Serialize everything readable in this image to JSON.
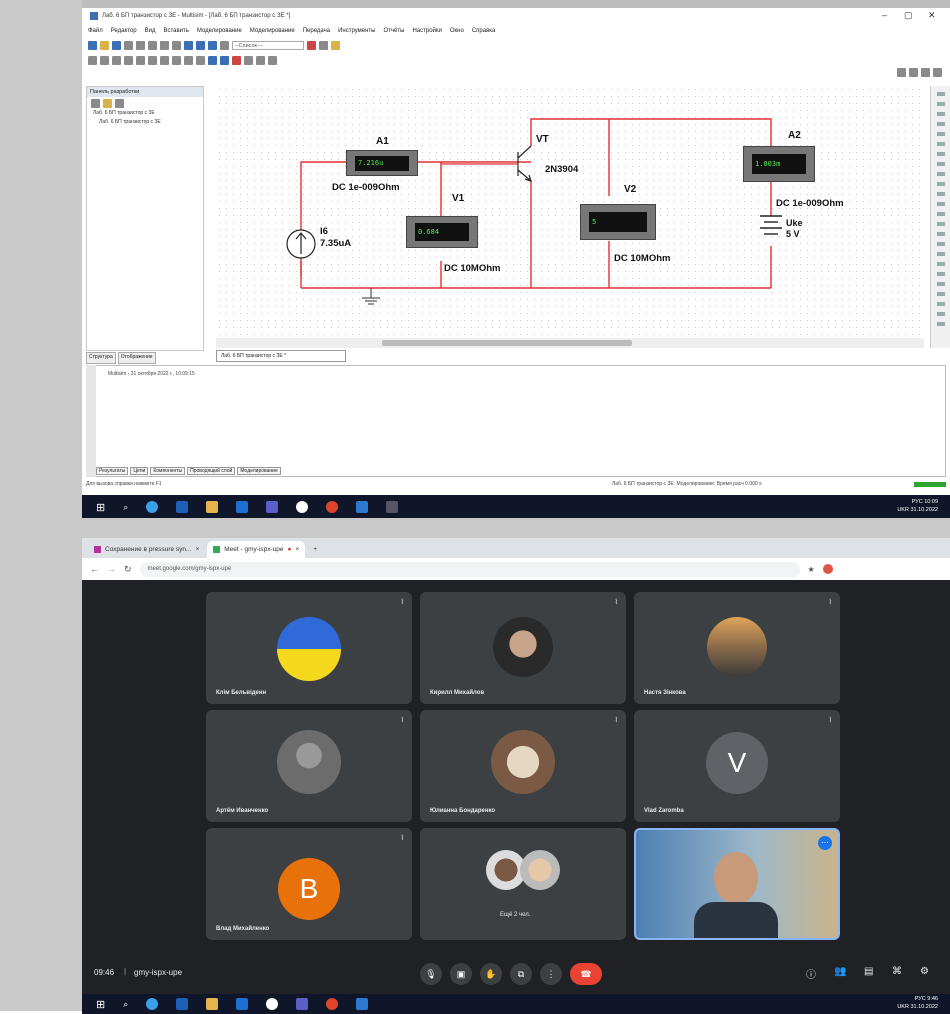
{
  "multisim": {
    "title": "Лаб. 6 БП транзистор с ЗЕ - Multisim - [Лаб. 6 БП транзистор с ЗЕ *]",
    "menu": [
      "Файл",
      "Редактор",
      "Вид",
      "Вставить",
      "Моделирование",
      "Моделирование",
      "Передача",
      "Инструменты",
      "Отчёты",
      "Настройки",
      "Окно",
      "Справка"
    ],
    "mode_dropdown": "--Список---",
    "sidebar": {
      "title": "Панель разработки",
      "items": [
        "Лаб. 6 БП транзистор с ЗЕ",
        "Лаб. 6 БП транзистор с ЗЕ"
      ]
    },
    "sidebar_tabs": [
      "Структура",
      "Отображение"
    ],
    "document_tab": "Лаб. 6 БП транзистор с ЗЕ *",
    "log_line": "Multisim - 31 октября 2022 г., 10:09:15",
    "log_tabs": [
      "Результаты",
      "Цепи",
      "Компоненты",
      "Проводящий слой",
      "Моделирование"
    ],
    "status_left": "Для вызова справки нажмите F1",
    "status_right": "Лаб. 6 БП транзистор с ЗЕ: Моделирование: Время расч 0.000 s",
    "circuit": {
      "A1": {
        "label": "A1",
        "value": "7.216u",
        "mode": "DC  1e-009Ohm"
      },
      "V1": {
        "label": "V1",
        "value": "0.684",
        "mode": "DC  10MOhm"
      },
      "V2": {
        "label": "V2",
        "value": "5",
        "mode": "DC  10MOhm"
      },
      "A2": {
        "label": "A2",
        "value": "1.003m",
        "mode": "DC  1e-009Ohm"
      },
      "source": {
        "name": "I6",
        "value": "7.35uA"
      },
      "transistor": {
        "name": "VT",
        "model": "2N3904"
      },
      "battery": {
        "name": "Uke",
        "value": "5 V"
      }
    }
  },
  "taskbar_top": {
    "lang": "РУС",
    "lang2": "UKR",
    "time": "10:09",
    "date": "31.10.2022"
  },
  "browser": {
    "tabs": [
      {
        "label": "Сохранение в pressure syn...",
        "close": "×"
      },
      {
        "label": "Meet - gmy-ispx-upe",
        "close": "×"
      }
    ],
    "new_tab": "+",
    "url": "meet.google.com/gmy-ispx-upe",
    "participants": [
      {
        "name": "Клім Бельвіденн",
        "avatar": "ua-flag"
      },
      {
        "name": "Кирилл Михайлов",
        "avatar": "photo"
      },
      {
        "name": "Настя Зінкова",
        "avatar": "photo"
      },
      {
        "name": "Артём Иванченко",
        "avatar": "photo"
      },
      {
        "name": "Юлианна Бондаренко",
        "avatar": "photo"
      },
      {
        "name": "Vlad Zaromba",
        "avatar": "letter",
        "letter": "V",
        "color": "#5f6368"
      },
      {
        "name": "Влад Михайленко",
        "avatar": "letter",
        "letter": "В",
        "color": "#e8710a"
      },
      {
        "name": "Ещё 2 чел.",
        "avatar": "group"
      },
      {
        "name": "",
        "avatar": "self-video"
      }
    ],
    "meeting_time": "09:46",
    "meeting_code": "gmy-ispx-upe"
  },
  "taskbar_bottom": {
    "lang": "РУС",
    "lang2": "UKR",
    "time": "9:46",
    "date": "31.10.2022"
  }
}
